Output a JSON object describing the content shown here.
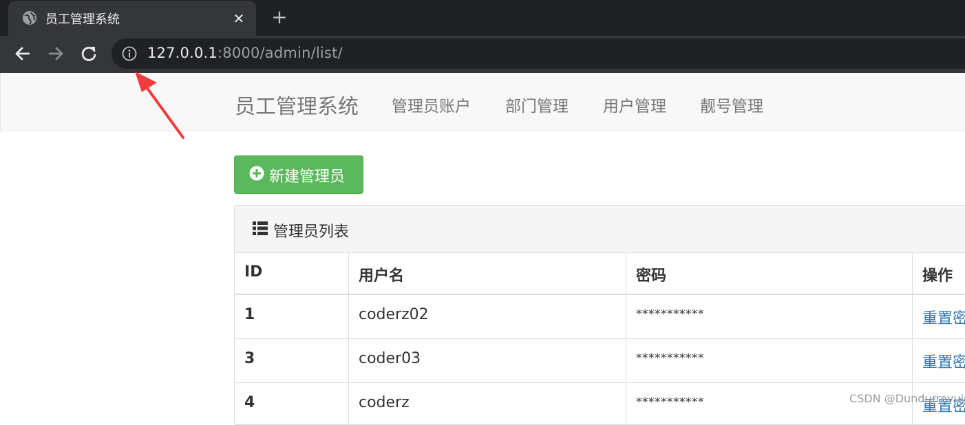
{
  "browser": {
    "tab_title": "员工管理系统",
    "tab_close_icon": "close-icon",
    "new_tab_icon": "plus-icon",
    "url_host": "127.0.0.1",
    "url_rest": ":8000/admin/list/"
  },
  "navbar": {
    "brand": "员工管理系统",
    "links": [
      "管理员账户",
      "部门管理",
      "用户管理",
      "靓号管理"
    ]
  },
  "actions": {
    "new_button_label": "新建管理员",
    "new_button_icon": "plus-circle-icon"
  },
  "panel": {
    "title": "管理员列表",
    "title_icon": "list-icon"
  },
  "table": {
    "headers": [
      "ID",
      "用户名",
      "密码",
      "操作"
    ],
    "rows": [
      {
        "id": "1",
        "username": "coderz02",
        "password": "***********",
        "action": "重置密"
      },
      {
        "id": "3",
        "username": "coder03",
        "password": "***********",
        "action": "重置密"
      },
      {
        "id": "4",
        "username": "coderz",
        "password": "***********",
        "action": "重置密"
      }
    ]
  },
  "watermark": "CSDN @Dundurrevuin",
  "colors": {
    "success": "#5cb85c",
    "link": "#337ab7",
    "annotation_arrow": "#f03c3c"
  }
}
